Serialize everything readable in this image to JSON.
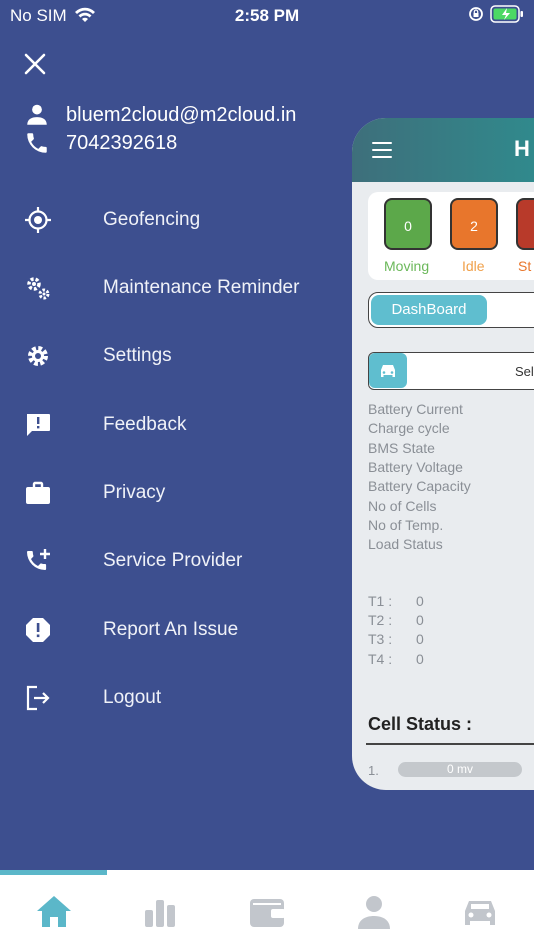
{
  "status_bar": {
    "carrier": "No SIM",
    "time": "2:58 PM",
    "icons": [
      "wifi-icon",
      "orientation-lock-icon",
      "battery-charging-icon"
    ]
  },
  "drawer": {
    "email": "bluem2cloud@m2cloud.in",
    "phone": "7042392618",
    "menu": [
      {
        "label": "Geofencing",
        "icon": "geofence-icon"
      },
      {
        "label": "Maintenance Reminder",
        "icon": "gears-icon"
      },
      {
        "label": "Settings",
        "icon": "gear-icon"
      },
      {
        "label": "Feedback",
        "icon": "feedback-icon"
      },
      {
        "label": "Privacy",
        "icon": "briefcase-icon"
      },
      {
        "label": "Service Provider",
        "icon": "phone-add-icon"
      },
      {
        "label": "Report An Issue",
        "icon": "alert-icon"
      },
      {
        "label": "Logout",
        "icon": "logout-icon"
      }
    ]
  },
  "background_app": {
    "header_title": "H",
    "stats": [
      {
        "label": "Moving",
        "value": "0",
        "color": "#5ca84a",
        "label_color": "#6bb85a"
      },
      {
        "label": "Idle",
        "value": "2",
        "color": "#e8762c",
        "label_color": "#f0a04a"
      },
      {
        "label": "St",
        "value": "",
        "color": "#b83a2a",
        "label_color": "#e8762c"
      }
    ],
    "tab_active": "DashBoard",
    "vehicle_select": "Sele",
    "info_rows": [
      "Battery Current",
      "Charge cycle",
      "BMS State",
      "Battery Voltage",
      "Battery Capacity",
      "No of Cells",
      "No of Temp.",
      "Load Status"
    ],
    "temps": [
      {
        "label": "T1 :",
        "value": "0"
      },
      {
        "label": "T2 :",
        "value": "0"
      },
      {
        "label": "T3 :",
        "value": "0"
      },
      {
        "label": "T4 :",
        "value": "0"
      }
    ],
    "cell_status_title": "Cell Status :",
    "cell_rows": [
      {
        "index": "1.",
        "value": "0 mv"
      }
    ]
  },
  "tab_bar": {
    "tabs": [
      {
        "icon": "home-icon",
        "active": true
      },
      {
        "icon": "bar-chart-icon",
        "active": false
      },
      {
        "icon": "wallet-icon",
        "active": false
      },
      {
        "icon": "person-icon",
        "active": false
      },
      {
        "icon": "car-icon",
        "active": false
      }
    ],
    "active_color": "#5bb7c9",
    "inactive_color": "#c2c6cc"
  },
  "colors": {
    "drawer_bg": "#3d4f8f",
    "accent": "#5fbecf"
  }
}
